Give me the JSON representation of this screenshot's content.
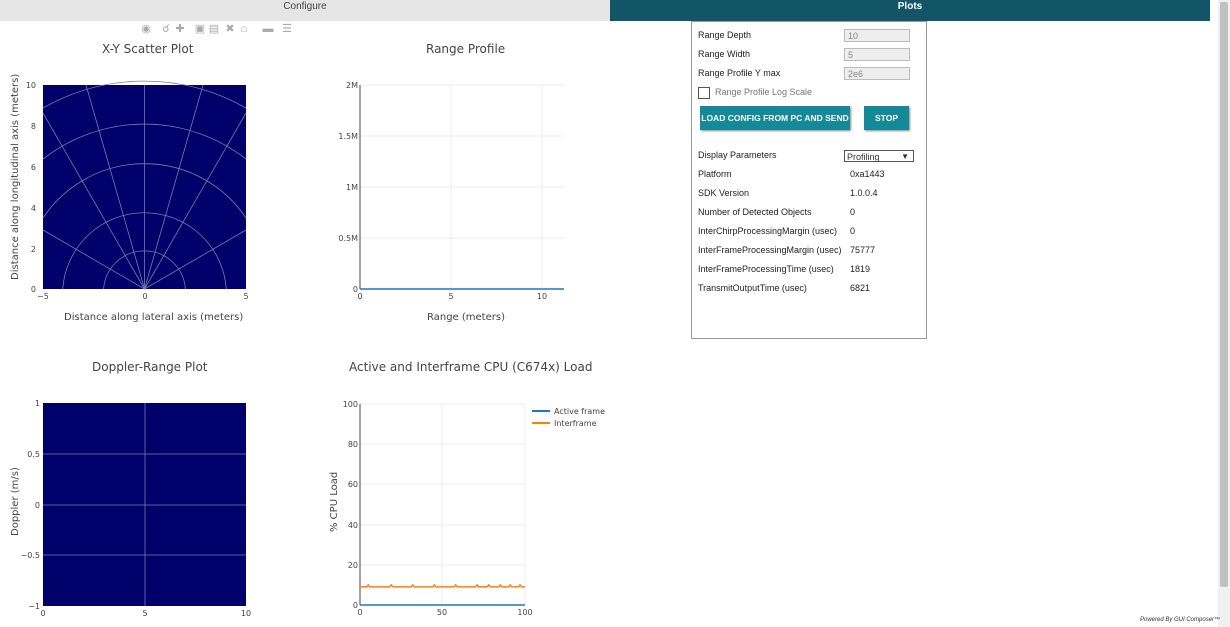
{
  "tabs": [
    {
      "label": "Configure",
      "active": false
    },
    {
      "label": "Plots",
      "active": true
    }
  ],
  "modebar_icons": [
    "camera-icon",
    "zoom-icon",
    "pan-icon",
    "zoom-in-icon",
    "zoom-out-icon",
    "autoscale-icon",
    "home-icon",
    "spike-icon",
    "hover-compare-icon"
  ],
  "scatter": {
    "title": "X-Y Scatter Plot",
    "xlabel": "Distance along lateral axis (meters)",
    "ylabel": "Distance along longitudinal axis (meters)",
    "xticks": [
      "−5",
      "0",
      "5"
    ],
    "yticks": [
      "0",
      "2",
      "4",
      "6",
      "8",
      "10"
    ]
  },
  "range_profile": {
    "title": "Range Profile",
    "xlabel": "Range (meters)",
    "xticks": [
      "0",
      "5",
      "10"
    ],
    "yticks": [
      "0",
      "0.5M",
      "1M",
      "1.5M",
      "2M"
    ]
  },
  "doppler": {
    "title": "Doppler-Range Plot",
    "ylabel": "Doppler (m/s)",
    "xticks": [
      "0",
      "5",
      "10"
    ],
    "yticks": [
      "−1",
      "−0.5",
      "0",
      "0.5",
      "1"
    ]
  },
  "cpu": {
    "title": "Active and Interframe  CPU (C674x) Load",
    "ylabel": "% CPU Load",
    "xticks": [
      "0",
      "50",
      "100"
    ],
    "yticks": [
      "0",
      "20",
      "40",
      "60",
      "80",
      "100"
    ],
    "legend": [
      "Active frame",
      "Interframe"
    ]
  },
  "colors": {
    "plot_bg": "#00006b",
    "tab_active": "#115566",
    "button": "#148a99",
    "active_frame": "#1f77b4",
    "interframe": "#ff7f0e"
  },
  "chart_data": [
    {
      "type": "scatter",
      "title": "X-Y Scatter Plot",
      "xlabel": "Distance along lateral axis (meters)",
      "ylabel": "Distance along longitudinal axis (meters)",
      "xlim": [
        -5,
        5
      ],
      "ylim": [
        0,
        10
      ],
      "series": [],
      "grid": true
    },
    {
      "type": "line",
      "title": "Range Profile",
      "xlabel": "Range (meters)",
      "ylabel": "",
      "xlim": [
        0,
        11.2
      ],
      "ylim": [
        0,
        2000000
      ],
      "series": [
        {
          "x": [
            0,
            11.2
          ],
          "values": [
            0,
            0
          ]
        }
      ],
      "grid": true
    },
    {
      "type": "heatmap",
      "title": "Doppler-Range Plot",
      "xlabel": "",
      "ylabel": "Doppler (m/s)",
      "xlim": [
        0,
        10
      ],
      "ylim": [
        -1,
        1
      ],
      "series": [],
      "grid": true
    },
    {
      "type": "line",
      "title": "Active and Interframe  CPU (C674x) Load",
      "xlabel": "",
      "ylabel": "% CPU Load",
      "xlim": [
        0,
        100
      ],
      "ylim": [
        0,
        100
      ],
      "legend_position": "top-right",
      "series": [
        {
          "name": "Active frame",
          "x": [
            0,
            100
          ],
          "values": [
            0,
            0
          ]
        },
        {
          "name": "Interframe",
          "x": [
            0,
            4,
            5,
            6,
            18,
            19,
            20,
            31,
            32,
            33,
            44,
            45,
            46,
            57,
            58,
            59,
            70,
            71,
            72,
            77,
            78,
            79,
            84,
            85,
            86,
            90,
            91,
            92,
            96,
            97,
            98,
            100
          ],
          "values": [
            9,
            9,
            10,
            9,
            9,
            10,
            9,
            9,
            10,
            9,
            9,
            10,
            9,
            9,
            10,
            9,
            9,
            10,
            9,
            9,
            10,
            9,
            9,
            10,
            9,
            9,
            10,
            9,
            9,
            10,
            9,
            9
          ]
        }
      ]
    }
  ],
  "panel": {
    "range_depth_label": "Range Depth",
    "range_depth_value": "10",
    "range_width_label": "Range Width",
    "range_width_value": "5",
    "range_ymax_label": "Range Profile Y max",
    "range_ymax_value": "2e6",
    "log_scale_label": "Range Profile Log Scale",
    "load_button": "LOAD CONFIG FROM PC AND SEND",
    "stop_button": "STOP",
    "display_params_label": "Display Parameters",
    "display_params_value": "Profiling",
    "stats": [
      {
        "label": "Platform",
        "value": "0xa1443"
      },
      {
        "label": "SDK Version",
        "value": "1.0.0.4"
      },
      {
        "label": "Number of Detected Objects",
        "value": "0"
      },
      {
        "label": "InterChirpProcessingMargin (usec)",
        "value": "0"
      },
      {
        "label": "InterFrameProcessingMargin (usec)",
        "value": "75777"
      },
      {
        "label": "InterFrameProcessingTime (usec)",
        "value": "1819"
      },
      {
        "label": "TransmitOutputTime (usec)",
        "value": "6821"
      }
    ]
  },
  "footer": "Powered By GUI Composer™"
}
